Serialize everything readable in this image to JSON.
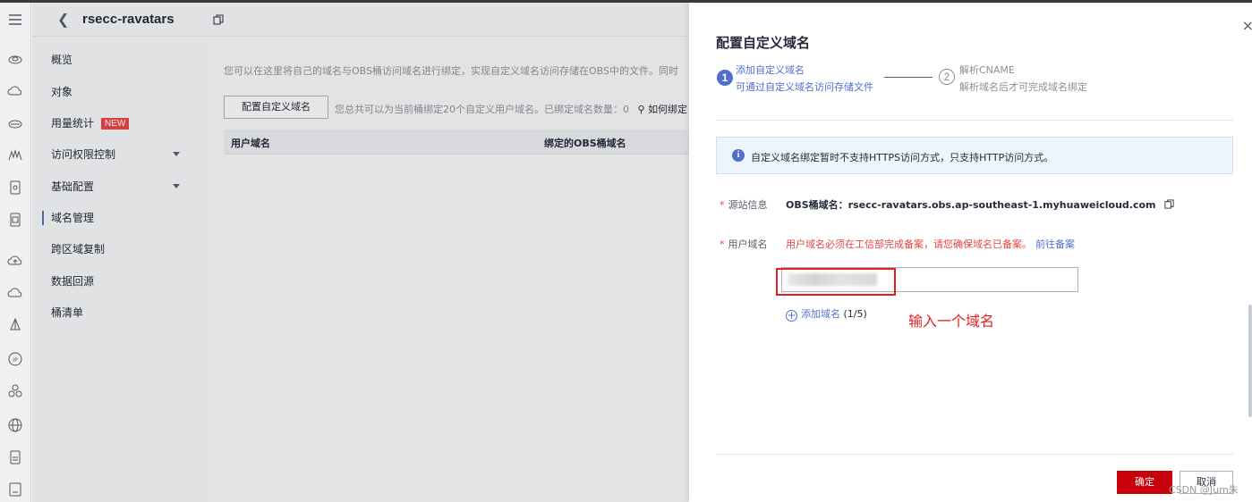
{
  "header": {
    "back_icon": "chevron-left-icon",
    "bucket_name": "rsecc-ravatars",
    "copy_icon": "copy-icon"
  },
  "rail": {
    "icons": [
      "menu-icon",
      "cloud-icon",
      "cloud-storage-icon",
      "database-icon",
      "mountain-icon",
      "safe-icon",
      "document-icon",
      "cloud-upload-icon",
      "cloud-icon",
      "lighthouse-icon",
      "ip-icon",
      "cluster-icon",
      "globe-icon",
      "file-icon",
      "server-icon"
    ]
  },
  "subnav": {
    "items": [
      {
        "label": "概览"
      },
      {
        "label": "对象"
      },
      {
        "label": "用量统计",
        "badge": "NEW"
      },
      {
        "label": "访问权限控制"
      },
      {
        "label": "基础配置"
      },
      {
        "label": "域名管理"
      },
      {
        "label": "跨区域复制"
      },
      {
        "label": "数据回源"
      },
      {
        "label": "桶清单"
      }
    ]
  },
  "main": {
    "description": "您可以在这里将自己的域名与OBS桶访问域名进行绑定，实现自定义域名访问存储在OBS中的文件。同时",
    "config_button": "配置自定义域名",
    "quota_text": "您总共可以为当前桶绑定20个自定义用户域名。已绑定域名数量：0",
    "how_to_bind": "如何绑定",
    "table_headers": [
      "用户域名",
      "绑定的OBS桶域名"
    ]
  },
  "drawer": {
    "title": "配置自定义域名",
    "steps": [
      {
        "number": "1",
        "title": "添加自定义域名",
        "desc": "可通过自定义域名访问存储文件"
      },
      {
        "number": "2",
        "title": "解析CNAME",
        "desc": "解析域名后才可完成域名绑定"
      }
    ],
    "info": "自定义域名绑定暂时不支持HTTPS访问方式，只支持HTTP访问方式。",
    "source_label": "源站信息",
    "source_prefix": "OBS桶域名：",
    "source_value": "rsecc-ravatars.obs.ap-southeast-1.myhuaweicloud.com",
    "domain_label": "用户域名",
    "warning": "用户域名必须在工信部完成备案，请您确保域名已备案。",
    "warning_link": "前往备案",
    "add_domain": "添加域名",
    "add_domain_count": "(1/5)",
    "annotation": "输入一个域名",
    "ok_button": "确定",
    "cancel_button": "取消",
    "watermark": "CSDN @Jum朱",
    "required_mark": "*",
    "close": "×"
  },
  "colors": {
    "accent": "#526ecc",
    "danger": "#e54545",
    "primary_button": "#c7000b",
    "annotation": "#e02020"
  }
}
